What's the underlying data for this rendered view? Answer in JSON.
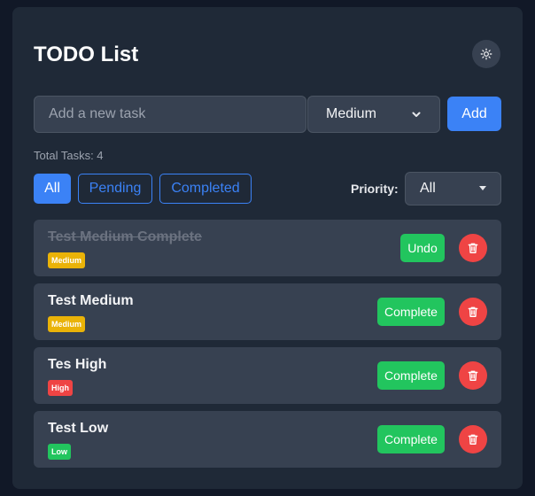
{
  "app": {
    "title": "TODO List"
  },
  "theme_toggle": {
    "icon": "sun-icon"
  },
  "new_task": {
    "placeholder": "Add a new task",
    "priority_selected": "Medium",
    "add_label": "Add"
  },
  "summary": {
    "total_text": "Total Tasks: 4"
  },
  "filters": {
    "buttons": [
      {
        "label": "All",
        "active": true
      },
      {
        "label": "Pending",
        "active": false
      },
      {
        "label": "Completed",
        "active": false
      }
    ],
    "priority_label": "Priority:",
    "priority_selected": "All"
  },
  "tasks": [
    {
      "title": "Test Medium Complete",
      "priority": "Medium",
      "completed": true,
      "action_label": "Undo"
    },
    {
      "title": "Test Medium",
      "priority": "Medium",
      "completed": false,
      "action_label": "Complete"
    },
    {
      "title": "Tes High",
      "priority": "High",
      "completed": false,
      "action_label": "Complete"
    },
    {
      "title": "Test Low",
      "priority": "Low",
      "completed": false,
      "action_label": "Complete"
    }
  ],
  "colors": {
    "background": "#111827",
    "card": "#1f2937",
    "accent": "#3b82f6",
    "complete": "#22c55e",
    "delete": "#ef4444",
    "priority_medium": "#eab308",
    "priority_high": "#ef4444",
    "priority_low": "#22c55e"
  }
}
